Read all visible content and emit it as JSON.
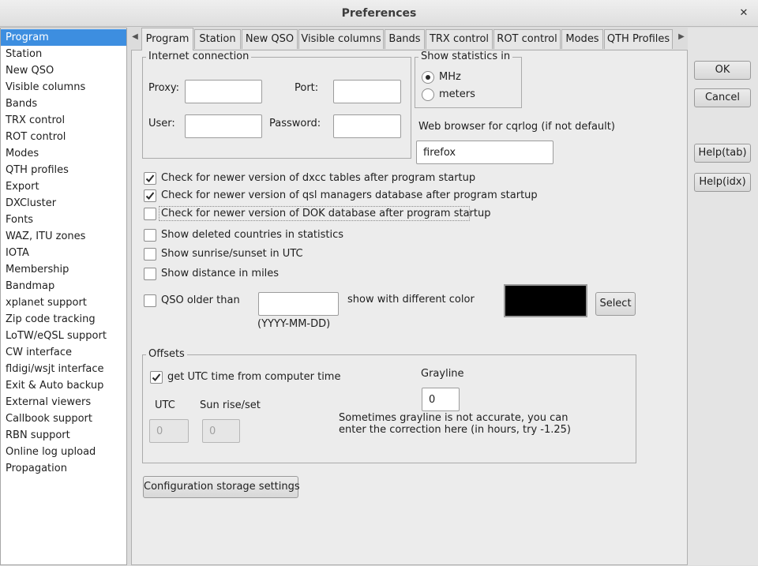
{
  "window": {
    "title": "Preferences"
  },
  "sidebar": {
    "items": [
      {
        "label": "Program",
        "selected": true
      },
      {
        "label": "Station"
      },
      {
        "label": "New QSO"
      },
      {
        "label": "Visible columns"
      },
      {
        "label": "Bands"
      },
      {
        "label": "TRX control"
      },
      {
        "label": "ROT control"
      },
      {
        "label": "Modes"
      },
      {
        "label": "QTH profiles"
      },
      {
        "label": "Export"
      },
      {
        "label": "DXCluster"
      },
      {
        "label": "Fonts"
      },
      {
        "label": "WAZ, ITU zones"
      },
      {
        "label": "IOTA"
      },
      {
        "label": "Membership"
      },
      {
        "label": "Bandmap"
      },
      {
        "label": "xplanet support"
      },
      {
        "label": "Zip code tracking"
      },
      {
        "label": "LoTW/eQSL support"
      },
      {
        "label": "CW interface"
      },
      {
        "label": "fldigi/wsjt interface"
      },
      {
        "label": "Exit & Auto backup"
      },
      {
        "label": "External viewers"
      },
      {
        "label": "Callbook support"
      },
      {
        "label": "RBN support"
      },
      {
        "label": "Online log upload"
      },
      {
        "label": "Propagation"
      }
    ],
    "selected_color": "#3d8ee0"
  },
  "tabs": [
    "Program",
    "Station",
    "New QSO",
    "Visible columns",
    "Bands",
    "TRX control",
    "ROT control",
    "Modes",
    "QTH Profiles"
  ],
  "internet": {
    "legend": "Internet connection",
    "proxy_label": "Proxy:",
    "proxy_value": "",
    "port_label": "Port:",
    "port_value": "",
    "user_label": "User:",
    "user_value": "",
    "password_label": "Password:",
    "password_value": ""
  },
  "stats": {
    "legend": "Show statistics in",
    "mhz_label": "MHz",
    "meters_label": "meters",
    "selected": "MHz"
  },
  "browser": {
    "label": "Web browser for cqrlog (if not default)",
    "value": "firefox"
  },
  "checks": {
    "dxcc": {
      "label": "Check for newer version of dxcc tables after program startup",
      "checked": true
    },
    "qsl": {
      "label": "Check for newer version of qsl managers database  after program startup",
      "checked": true
    },
    "dok": {
      "label": "Check for newer version of DOK database  after program startup",
      "checked": false
    },
    "deleted": {
      "label": "Show deleted countries in statistics",
      "checked": false
    },
    "sunrise": {
      "label": "Show sunrise/sunset in UTC",
      "checked": false
    },
    "miles": {
      "label": "Show distance in miles",
      "checked": false
    }
  },
  "qso_older": {
    "label": "QSO older than",
    "checked": false,
    "value": "",
    "hint": "(YYYY-MM-DD)",
    "color_label": "show with different color",
    "swatch_color": "#000000",
    "select_label": "Select"
  },
  "offsets": {
    "legend": "Offsets",
    "utc_from_computer": {
      "label": "get UTC time from computer time",
      "checked": true
    },
    "utc_label": "UTC",
    "utc_value": "0",
    "sunrise_label": "Sun rise/set",
    "sunrise_value": "0",
    "grayline_label": "Grayline",
    "grayline_value": "0",
    "note_line1": "Sometimes grayline is not accurate, you can",
    "note_line2": "enter the correction here (in hours, try -1.25)"
  },
  "config_button": "Configuration storage settings",
  "buttons": {
    "ok": "OK",
    "cancel": "Cancel",
    "help_tab": "Help(tab)",
    "help_idx": "Help(idx)"
  }
}
